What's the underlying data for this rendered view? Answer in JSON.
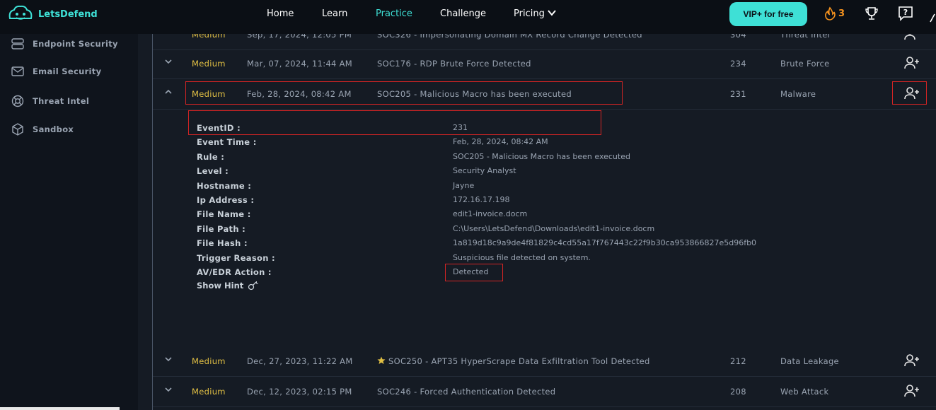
{
  "brand": {
    "name": "LetsDefend"
  },
  "nav": {
    "home": "Home",
    "learn": "Learn",
    "practice": "Practice",
    "challenge": "Challenge",
    "pricing": "Pricing"
  },
  "header": {
    "vip_label": "VIP+ for free",
    "streak_count": "3"
  },
  "sidebar": {
    "items": [
      {
        "label": "Endpoint Security",
        "icon": "server-icon"
      },
      {
        "label": "Email Security",
        "icon": "mail-icon"
      },
      {
        "label": "Threat Intel",
        "icon": "lifebuoy-icon"
      },
      {
        "label": "Sandbox",
        "icon": "cube-icon"
      }
    ]
  },
  "alerts": {
    "rows": [
      {
        "severity": "Medium",
        "date": "Sep, 17, 2024, 12:05 PM",
        "rule": "SOC326 - Impersonating Domain MX Record Change Detected",
        "event_id": "304",
        "type": "Threat Intel"
      },
      {
        "severity": "Medium",
        "date": "Mar, 07, 2024, 11:44 AM",
        "rule": "SOC176 - RDP Brute Force Detected",
        "event_id": "234",
        "type": "Brute Force"
      },
      {
        "severity": "Medium",
        "date": "Feb, 28, 2024, 08:42 AM",
        "rule": "SOC205 - Malicious Macro has been executed",
        "event_id": "231",
        "type": "Malware"
      },
      {
        "severity": "Medium",
        "date": "Dec, 27, 2023, 11:22 AM",
        "rule": "SOC250 - APT35 HyperScrape Data Exfiltration Tool Detected",
        "event_id": "212",
        "type": "Data Leakage"
      },
      {
        "severity": "Medium",
        "date": "Dec, 12, 2023, 02:15 PM",
        "rule": "SOC246 - Forced Authentication Detected",
        "event_id": "208",
        "type": "Web Attack"
      }
    ],
    "detail": {
      "fields": [
        {
          "label": "EventID :",
          "value": "231"
        },
        {
          "label": "Event Time :",
          "value": "Feb, 28, 2024, 08:42 AM"
        },
        {
          "label": "Rule :",
          "value": "SOC205 - Malicious Macro has been executed"
        },
        {
          "label": "Level :",
          "value": "Security Analyst"
        },
        {
          "label": "Hostname :",
          "value": "Jayne"
        },
        {
          "label": "Ip Address :",
          "value": "172.16.17.198"
        },
        {
          "label": "File Name :",
          "value": "edit1-invoice.docm"
        },
        {
          "label": "File Path :",
          "value": "C:\\Users\\LetsDefend\\Downloads\\edit1-invoice.docm"
        },
        {
          "label": "File Hash :",
          "value": "1a819d18c9a9de4f81829c4cd55a17f767443c22f9b30ca953866827e5d96fb0"
        },
        {
          "label": "Trigger Reason :",
          "value": "Suspicious file detected on system."
        },
        {
          "label": "AV/EDR Action :",
          "value": "Detected"
        }
      ],
      "show_hint": "Show Hint"
    }
  },
  "colors": {
    "accent": "#3ee0d6",
    "severity_medium": "#e2c044",
    "highlight": "#d22424",
    "streak": "#f7931e"
  }
}
